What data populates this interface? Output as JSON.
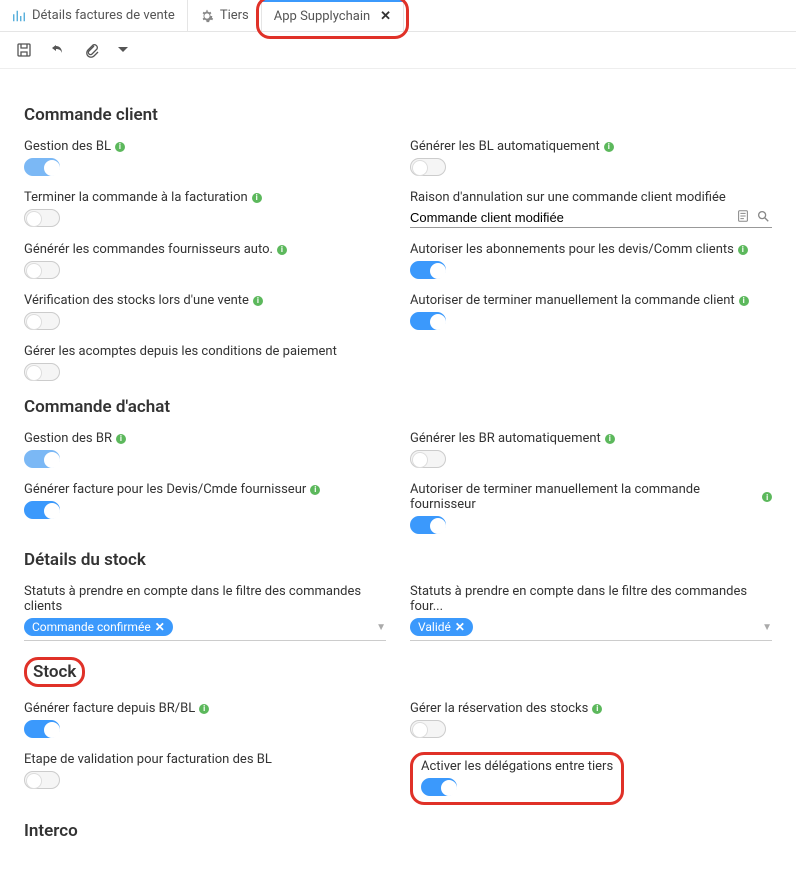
{
  "tabs": {
    "items": [
      {
        "label": "Détails factures de vente"
      },
      {
        "label": "Tiers"
      },
      {
        "label": "App Supplychain"
      }
    ]
  },
  "sections": {
    "client": {
      "title": "Commande client",
      "gestion_bl": "Gestion des BL",
      "generer_bl_auto": "Générer les BL automatiquement",
      "terminer_facturation": "Terminer la commande à la facturation",
      "raison_annulation": "Raison d'annulation sur une commande client modifiée",
      "raison_value": "Commande client modifiée",
      "generer_fournisseurs": "Générér les commandes fournisseurs auto.",
      "autoriser_abonnements": "Autoriser les abonnements pour les devis/Comm clients",
      "verif_stocks": "Vérification des stocks lors d'une vente",
      "autoriser_terminer": "Autoriser de terminer manuellement la commande client",
      "gerer_acomptes": "Gérer les acomptes depuis les conditions de paiement"
    },
    "achat": {
      "title": "Commande d'achat",
      "gestion_br": "Gestion des BR",
      "generer_br_auto": "Générer les BR automatiquement",
      "generer_facture": "Générer facture pour les Devis/Cmde fournisseur",
      "autoriser_terminer": "Autoriser de terminer manuellement la commande fournisseur"
    },
    "details_stock": {
      "title": "Détails du stock",
      "statuts_clients": "Statuts à prendre en compte dans le filtre des commandes clients",
      "statuts_clients_tag": "Commande confirmée",
      "statuts_four": "Statuts à prendre en compte dans le filtre des commandes four...",
      "statuts_four_tag": "Validé"
    },
    "stock": {
      "title": "Stock",
      "generer_facture_br": "Générer facture depuis BR/BL",
      "gerer_reservation": "Gérer la réservation des stocks",
      "etape_validation": "Etape de validation pour facturation des BL",
      "activer_delegations": "Activer les délégations entre tiers"
    },
    "interco": {
      "title": "Interco"
    }
  }
}
